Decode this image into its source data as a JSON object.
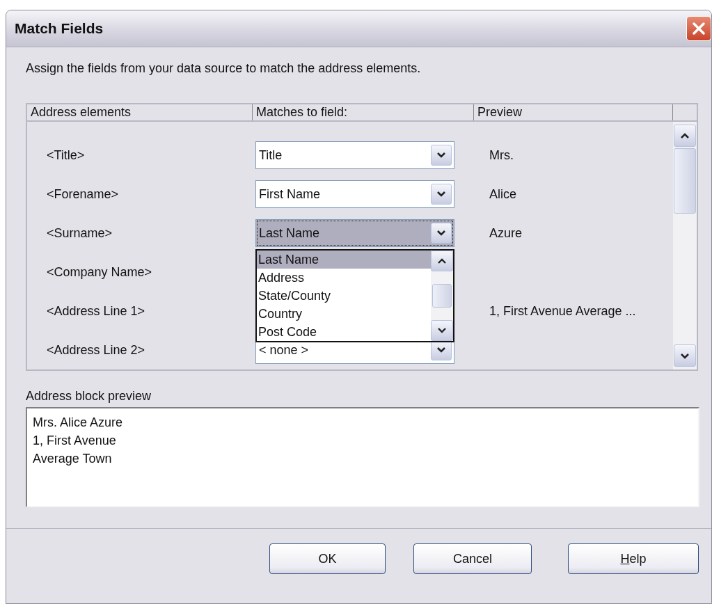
{
  "window": {
    "title": "Match Fields"
  },
  "instruction": "Assign the fields from your data source to match the address elements.",
  "table": {
    "columns": [
      "Address elements",
      "Matches to field:",
      "Preview"
    ],
    "rows": [
      {
        "element": "<Title>",
        "field": "Title",
        "preview": "Mrs.",
        "focused": false
      },
      {
        "element": "<Forename>",
        "field": "First Name",
        "preview": "Alice",
        "focused": false
      },
      {
        "element": "<Surname>",
        "field": "Last Name",
        "preview": "Azure",
        "focused": true
      },
      {
        "element": "<Company Name>",
        "focused": false
      },
      {
        "element": "<Address Line 1>",
        "preview": "1, First Avenue Average ...",
        "focused": false
      },
      {
        "element": "<Address Line 2>",
        "field": "< none >",
        "focused": false
      }
    ]
  },
  "dropdown": {
    "items": [
      {
        "label": "Last Name",
        "selected": true
      },
      {
        "label": "Address",
        "selected": false
      },
      {
        "label": "State/County",
        "selected": false
      },
      {
        "label": "Country",
        "selected": false
      },
      {
        "label": "Post Code",
        "selected": false
      }
    ]
  },
  "preview_label": "Address block preview",
  "preview_lines": [
    "Mrs. Alice Azure",
    "1, First Avenue",
    "Average Town"
  ],
  "buttons": [
    {
      "label": "OK",
      "mnemonic": false
    },
    {
      "label": "Cancel",
      "mnemonic": false
    },
    {
      "label": "Help",
      "mnemonic": true
    }
  ]
}
